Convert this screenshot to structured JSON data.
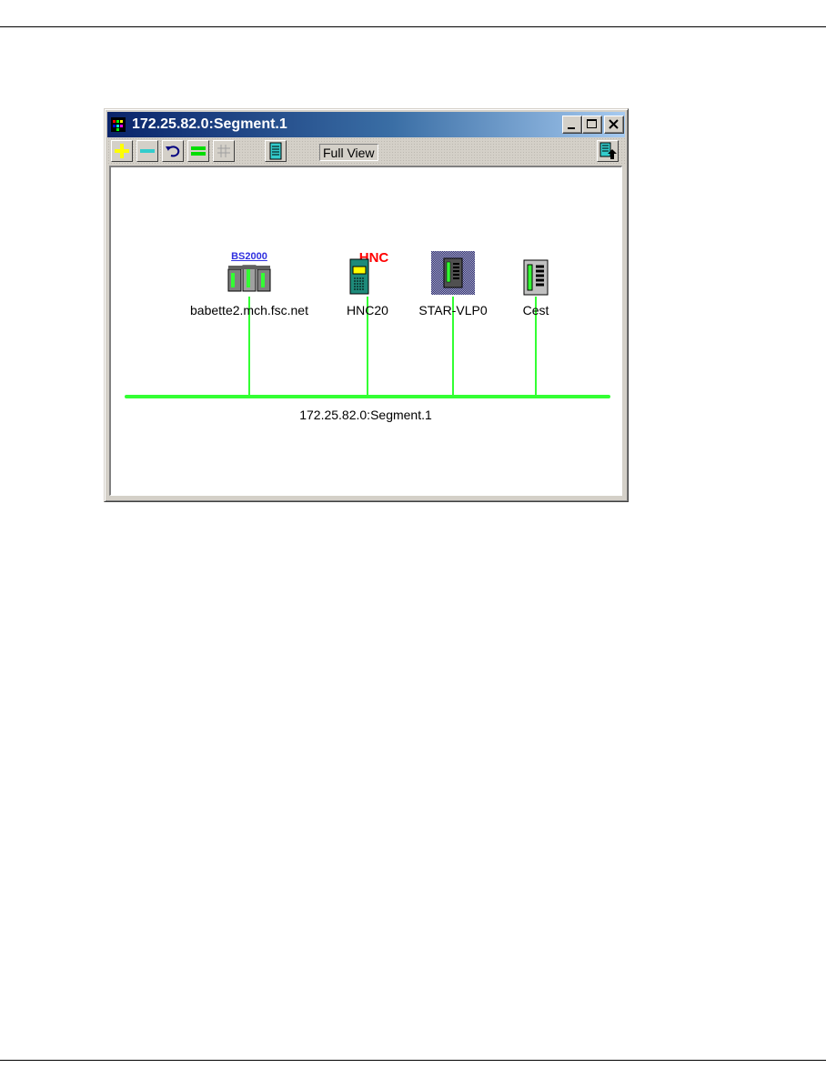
{
  "window": {
    "title": "172.25.82.0:Segment.1",
    "controls": [
      "minimize-icon",
      "maximize-icon",
      "close-icon"
    ]
  },
  "toolbar": {
    "tools": [
      {
        "name": "zoom-in",
        "icon": "plus-icon",
        "color": "#ffff00"
      },
      {
        "name": "zoom-out",
        "icon": "minus-icon",
        "color": "#33cccc"
      },
      {
        "name": "undo",
        "icon": "undo-arrow-icon",
        "color": "#000080"
      },
      {
        "name": "equal",
        "icon": "equals-icon",
        "color": "#00dd00"
      },
      {
        "name": "grid",
        "icon": "grid-icon",
        "color": "#a0a0a0"
      },
      {
        "name": "list-view",
        "icon": "list-icon",
        "color": "#33cccc"
      },
      {
        "name": "export",
        "icon": "export-icon",
        "color": "#33cccc"
      }
    ],
    "view_label": "Full View"
  },
  "map": {
    "wire_color": "#33ff33",
    "segment_label": "172.25.82.0:Segment.1",
    "nodes": [
      {
        "label": "babette2.mch.fsc.net",
        "badge": "BS2000",
        "icon": "server-cluster-icon"
      },
      {
        "label": "HNC20",
        "badge": "HNC",
        "icon": "hnc-device-icon"
      },
      {
        "label": "STAR-VLP0",
        "icon": "star-vlp-device-icon"
      },
      {
        "label": "Cest",
        "icon": "generic-device-icon"
      }
    ]
  }
}
